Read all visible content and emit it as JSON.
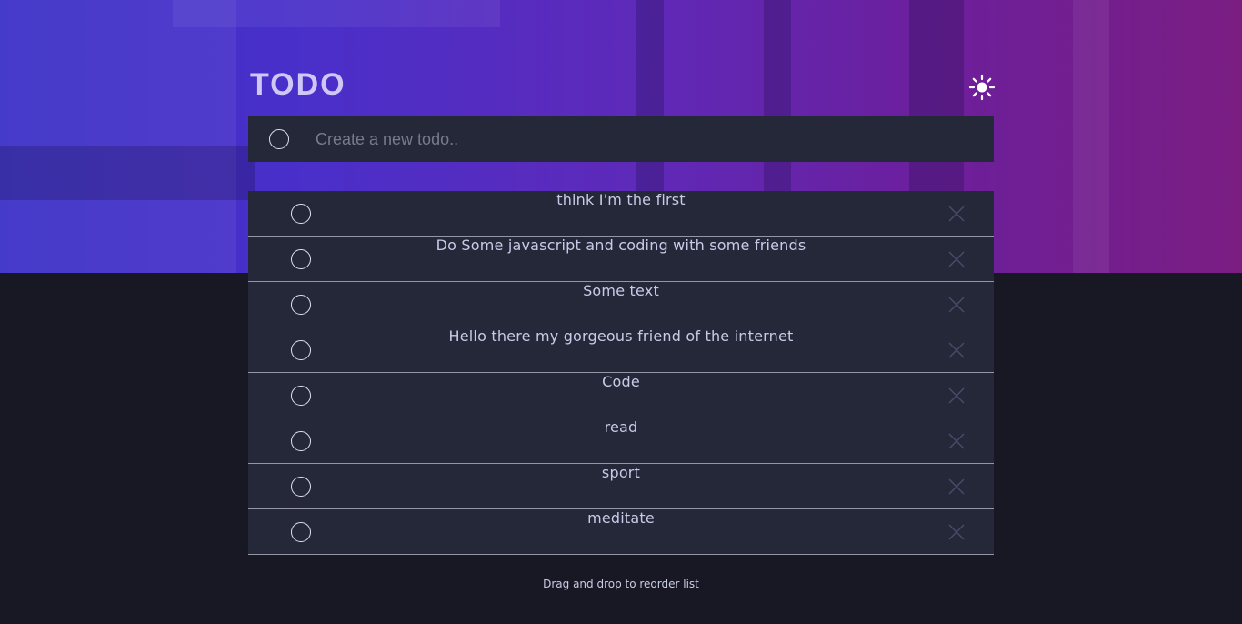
{
  "app": {
    "title": "TODO"
  },
  "theme_toggle": {
    "icon": "sun-icon"
  },
  "new_todo": {
    "placeholder": "Create a new todo.."
  },
  "todos": [
    {
      "text": "think I'm the first"
    },
    {
      "text": "Do Some javascript and coding with some friends"
    },
    {
      "text": "Some text"
    },
    {
      "text": "Hello there my gorgeous friend of the internet"
    },
    {
      "text": "Code"
    },
    {
      "text": "read"
    },
    {
      "text": "sport"
    },
    {
      "text": "meditate"
    }
  ],
  "footer": {
    "hint": "Drag and drop to reorder list"
  },
  "colors": {
    "page_bg": "#181824",
    "card_bg": "#252839",
    "text": "#c8cbe7",
    "gradient_start": "#3a2fc7",
    "gradient_end": "#7a1e82"
  }
}
